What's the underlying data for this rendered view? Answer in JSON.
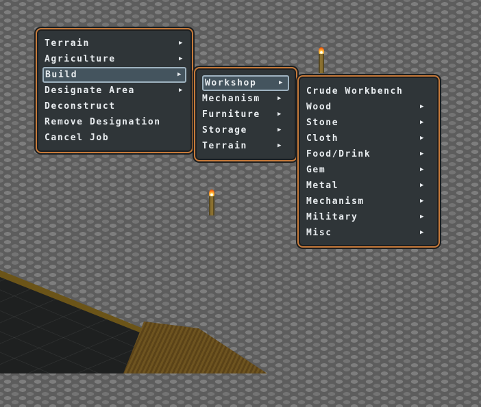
{
  "menus": {
    "main": {
      "items": [
        {
          "label": "Terrain",
          "has_submenu": true
        },
        {
          "label": "Agriculture",
          "has_submenu": true
        },
        {
          "label": "Build",
          "has_submenu": true
        },
        {
          "label": "Designate Area",
          "has_submenu": true
        },
        {
          "label": "Deconstruct",
          "has_submenu": false
        },
        {
          "label": "Remove Designation",
          "has_submenu": false
        },
        {
          "label": "Cancel Job",
          "has_submenu": false
        }
      ],
      "selected": "Build"
    },
    "build": {
      "items": [
        {
          "label": "Workshop",
          "has_submenu": true
        },
        {
          "label": "Mechanism",
          "has_submenu": true
        },
        {
          "label": "Furniture",
          "has_submenu": true
        },
        {
          "label": "Storage",
          "has_submenu": true
        },
        {
          "label": "Terrain",
          "has_submenu": true
        }
      ],
      "selected": "Workshop"
    },
    "workshop": {
      "items": [
        {
          "label": "Crude Workbench",
          "has_submenu": false
        },
        {
          "label": "Wood",
          "has_submenu": true
        },
        {
          "label": "Stone",
          "has_submenu": true
        },
        {
          "label": "Cloth",
          "has_submenu": true
        },
        {
          "label": "Food/Drink",
          "has_submenu": true
        },
        {
          "label": "Gem",
          "has_submenu": true
        },
        {
          "label": "Metal",
          "has_submenu": true
        },
        {
          "label": "Mechanism",
          "has_submenu": true
        },
        {
          "label": "Military",
          "has_submenu": true
        },
        {
          "label": "Misc",
          "has_submenu": true
        }
      ]
    }
  },
  "icons": {
    "submenu_arrow": "▶",
    "torch": "torch-icon"
  },
  "colors": {
    "menu_bg": "#2f3538",
    "menu_border": "#c77a3a",
    "selected_bg": "#44545e",
    "text": "#e8ecef"
  }
}
